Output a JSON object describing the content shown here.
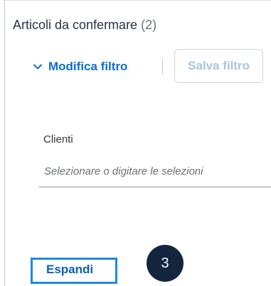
{
  "header": {
    "title": "Articoli da confermare",
    "count": "(2)"
  },
  "filter_bar": {
    "edit_filter_label": "Modifica filtro",
    "edit_filter_icon": "chevron-down-icon",
    "save_filter_label": "Salva filtro"
  },
  "filters": {
    "clienti_label": "Clienti",
    "clienti_placeholder": "Selezionare o digitare le selezioni"
  },
  "actions": {
    "expand_label": "Espandi"
  },
  "callout": {
    "step_number": "3"
  },
  "colors": {
    "accent": "#0a6ed1",
    "highlight": "#1e88e5",
    "badge": "#13253f"
  }
}
